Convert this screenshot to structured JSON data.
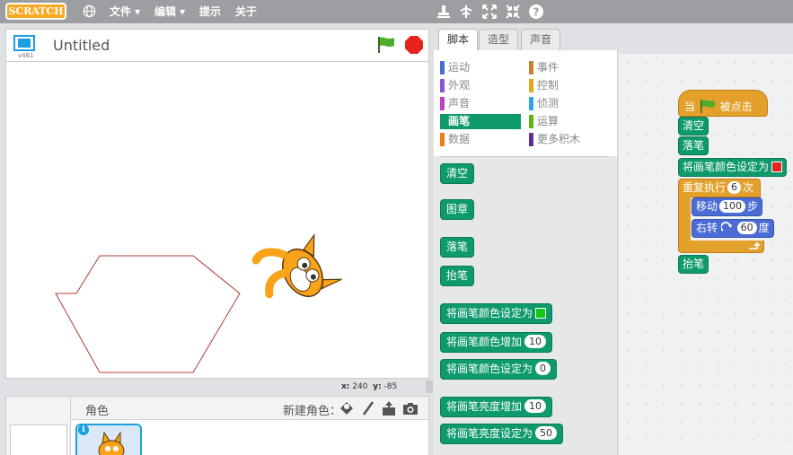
{
  "app": {
    "logo": "SCRATCH",
    "menu": [
      "文件 ▾",
      "编辑 ▾",
      "提示",
      "关于"
    ]
  },
  "stage": {
    "version": "v461",
    "project_title": "Untitled",
    "coords": {
      "x_label": "x:",
      "x": "240",
      "y_label": "y:",
      "y": "-85"
    }
  },
  "sprites": {
    "header": "角色",
    "new_sprite": "新建角色："
  },
  "tabs": [
    "脚本",
    "造型",
    "声音"
  ],
  "categories": [
    {
      "label": "运动",
      "color": "#4a6cd4"
    },
    {
      "label": "事件",
      "color": "#c88330"
    },
    {
      "label": "外观",
      "color": "#8a55d7"
    },
    {
      "label": "控制",
      "color": "#e1a91a"
    },
    {
      "label": "声音",
      "color": "#bb42c3"
    },
    {
      "label": "侦测",
      "color": "#2ca5e2"
    },
    {
      "label": "画笔",
      "color": "#0e9a6c"
    },
    {
      "label": "运算",
      "color": "#5cb712"
    },
    {
      "label": "数据",
      "color": "#ee7d16"
    },
    {
      "label": "更多积木",
      "color": "#632d99"
    }
  ],
  "palette_blocks": {
    "clear": "清空",
    "stamp": "图章",
    "pen_down": "落笔",
    "pen_up": "抬笔",
    "set_color_to": "将画笔颜色设定为",
    "change_color_by": "将画笔颜色增加",
    "change_color_by_value": "10",
    "set_color_to_num": "将画笔颜色设定为",
    "set_color_to_num_value": "0",
    "change_shade_by": "将画笔亮度增加",
    "change_shade_by_value": "10",
    "set_shade_to": "将画笔亮度设定为",
    "set_shade_to_value": "50"
  },
  "script": {
    "hat_when": "当",
    "hat_clicked": "被点击",
    "clear": "清空",
    "pen_down": "落笔",
    "set_color": "将画笔颜色设定为",
    "repeat": "重复执行",
    "repeat_count": "6",
    "repeat_suffix": "次",
    "move": "移动",
    "move_steps": "100",
    "move_suffix": "步",
    "turn": "右转",
    "turn_degrees": "60",
    "turn_suffix": "度",
    "pen_up": "抬笔"
  },
  "colors": {
    "pen_green": "#0e9a6c",
    "control_orange": "#e3a12c",
    "motion_blue": "#4a6cd4",
    "selected_sprite": "#1aa0e0",
    "stop_red": "#e6241b"
  }
}
